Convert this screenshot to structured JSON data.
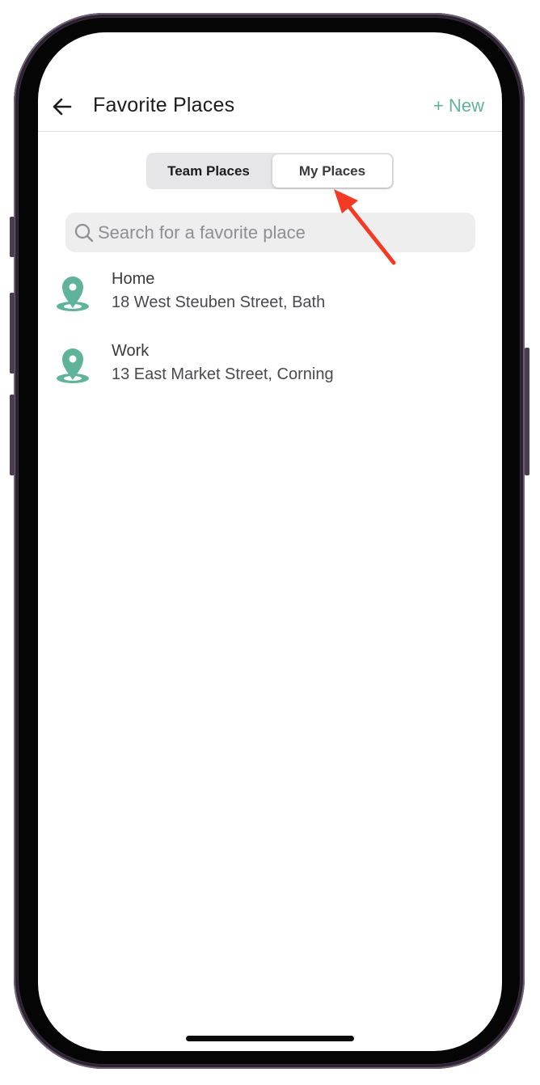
{
  "header": {
    "title": "Favorite Places",
    "new_label": "+ New"
  },
  "segments": {
    "team_label": "Team Places",
    "my_label": "My Places",
    "selected": "My Places"
  },
  "search": {
    "placeholder": "Search for a favorite place",
    "value": ""
  },
  "places": [
    {
      "name": "Home",
      "address": "18 West Steuben Street, Bath"
    },
    {
      "name": "Work",
      "address": "13 East Market Street, Corning"
    }
  ],
  "icons": {
    "back": "arrow-left-icon",
    "search": "magnifier-icon",
    "place": "map-pin-icon",
    "annotation": "red-arrow-icon"
  },
  "colors": {
    "accent": "#5fb39a",
    "annotation": "#f23a24",
    "segment_bg": "#e6e6e8",
    "search_bg": "#eeeeef"
  }
}
